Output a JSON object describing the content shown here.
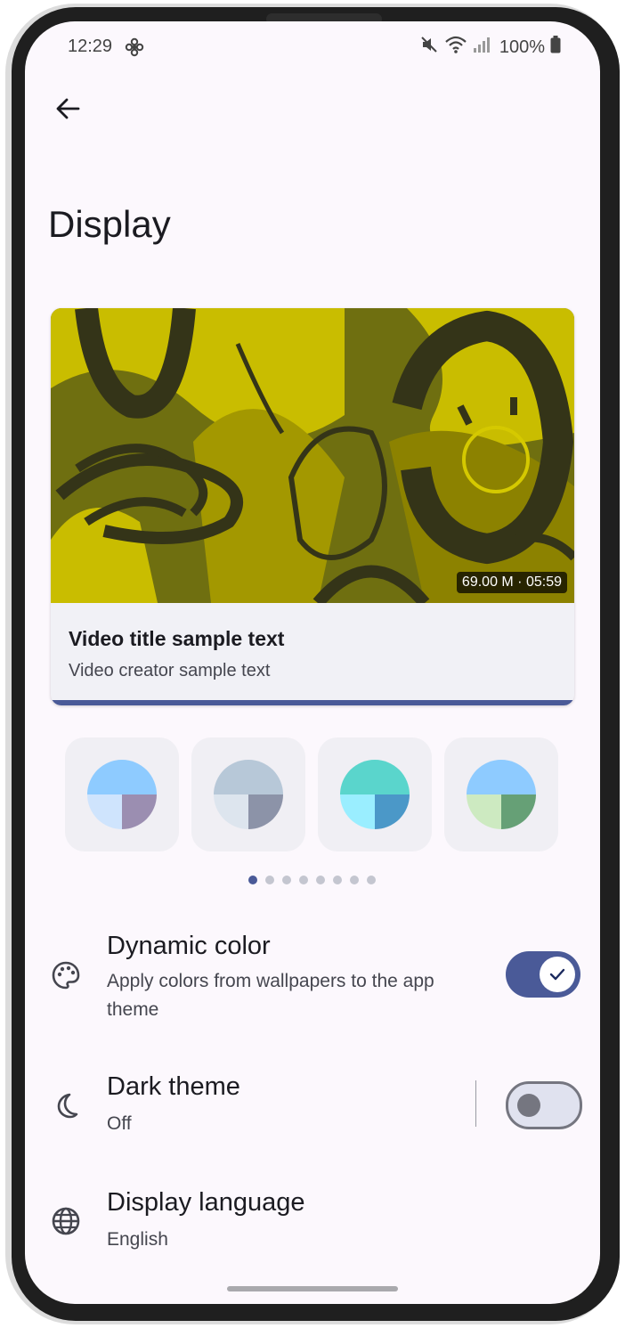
{
  "status_bar": {
    "time": "12:29",
    "battery": "100%"
  },
  "page": {
    "title": "Display"
  },
  "video_preview": {
    "duration_badge": "69.00 M · 05:59",
    "title": "Video title sample text",
    "creator": "Video creator sample text"
  },
  "color_swatches": [
    {
      "top": "#8ecbff",
      "bottom_left": "#cfe4fd",
      "bottom_right": "#9b8eb1"
    },
    {
      "top": "#b7c8d8",
      "bottom_left": "#dde5ee",
      "bottom_right": "#8c93a8"
    },
    {
      "top": "#5ad5cc",
      "bottom_left": "#9aeeff",
      "bottom_right": "#4b98c8"
    },
    {
      "top": "#8ecbff",
      "bottom_left": "#cdeac1",
      "bottom_right": "#66a076"
    }
  ],
  "pager": {
    "total": 8,
    "active": 0
  },
  "settings": {
    "dynamic_color": {
      "title": "Dynamic color",
      "subtitle": "Apply colors from wallpapers to the app theme",
      "enabled": true
    },
    "dark_theme": {
      "title": "Dark theme",
      "subtitle": "Off",
      "enabled": false
    },
    "display_language": {
      "title": "Display language",
      "subtitle": "English"
    }
  },
  "colors": {
    "accent": "#4a5a98",
    "background": "#fcf8fd",
    "thumbnail_yellow": "#cfc000",
    "thumbnail_dark": "#3a3a16"
  }
}
